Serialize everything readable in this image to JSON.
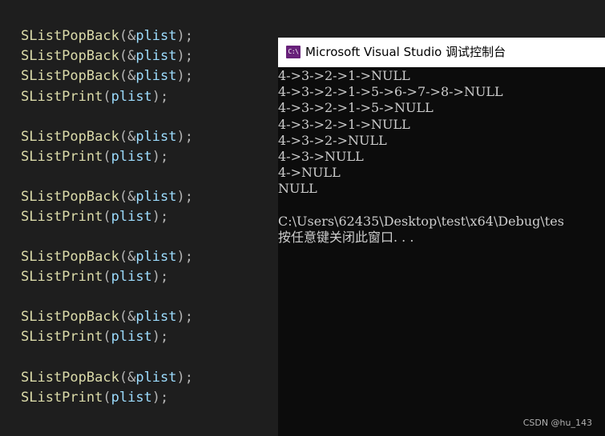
{
  "editor": {
    "lines": [
      {
        "fn": "SListPopBack",
        "arg_prefix": "&",
        "arg": "plist"
      },
      {
        "fn": "SListPopBack",
        "arg_prefix": "&",
        "arg": "plist"
      },
      {
        "fn": "SListPopBack",
        "arg_prefix": "&",
        "arg": "plist"
      },
      {
        "fn": "SListPrint",
        "arg_prefix": "",
        "arg": "plist"
      },
      {
        "fn": "SListPopBack",
        "arg_prefix": "&",
        "arg": "plist"
      },
      {
        "fn": "SListPrint",
        "arg_prefix": "",
        "arg": "plist"
      },
      {
        "fn": "SListPopBack",
        "arg_prefix": "&",
        "arg": "plist"
      },
      {
        "fn": "SListPrint",
        "arg_prefix": "",
        "arg": "plist"
      },
      {
        "fn": "SListPopBack",
        "arg_prefix": "&",
        "arg": "plist"
      },
      {
        "fn": "SListPrint",
        "arg_prefix": "",
        "arg": "plist"
      },
      {
        "fn": "SListPopBack",
        "arg_prefix": "&",
        "arg": "plist"
      },
      {
        "fn": "SListPrint",
        "arg_prefix": "",
        "arg": "plist"
      },
      {
        "fn": "SListPopBack",
        "arg_prefix": "&",
        "arg": "plist"
      },
      {
        "fn": "SListPrint",
        "arg_prefix": "",
        "arg": "plist"
      }
    ]
  },
  "console": {
    "icon_label": "C:\\",
    "title": "Microsoft Visual Studio 调试控制台",
    "output": [
      "4->3->2->1->NULL",
      "4->3->2->1->5->6->7->8->NULL",
      "4->3->2->1->5->NULL",
      "4->3->2->1->NULL",
      "4->3->2->NULL",
      "4->3->NULL",
      "4->NULL",
      "NULL",
      "",
      "C:\\Users\\62435\\Desktop\\test\\x64\\Debug\\tes",
      "按任意键关闭此窗口. . ."
    ]
  },
  "watermark": "CSDN @hu_143",
  "colors": {
    "editor_bg": "#1e1e1e",
    "function": "#dcdcaa",
    "variable": "#9cdcfe",
    "punctuation": "#b4b4b4",
    "console_bg": "#0c0c0c",
    "console_text": "#cccccc"
  }
}
